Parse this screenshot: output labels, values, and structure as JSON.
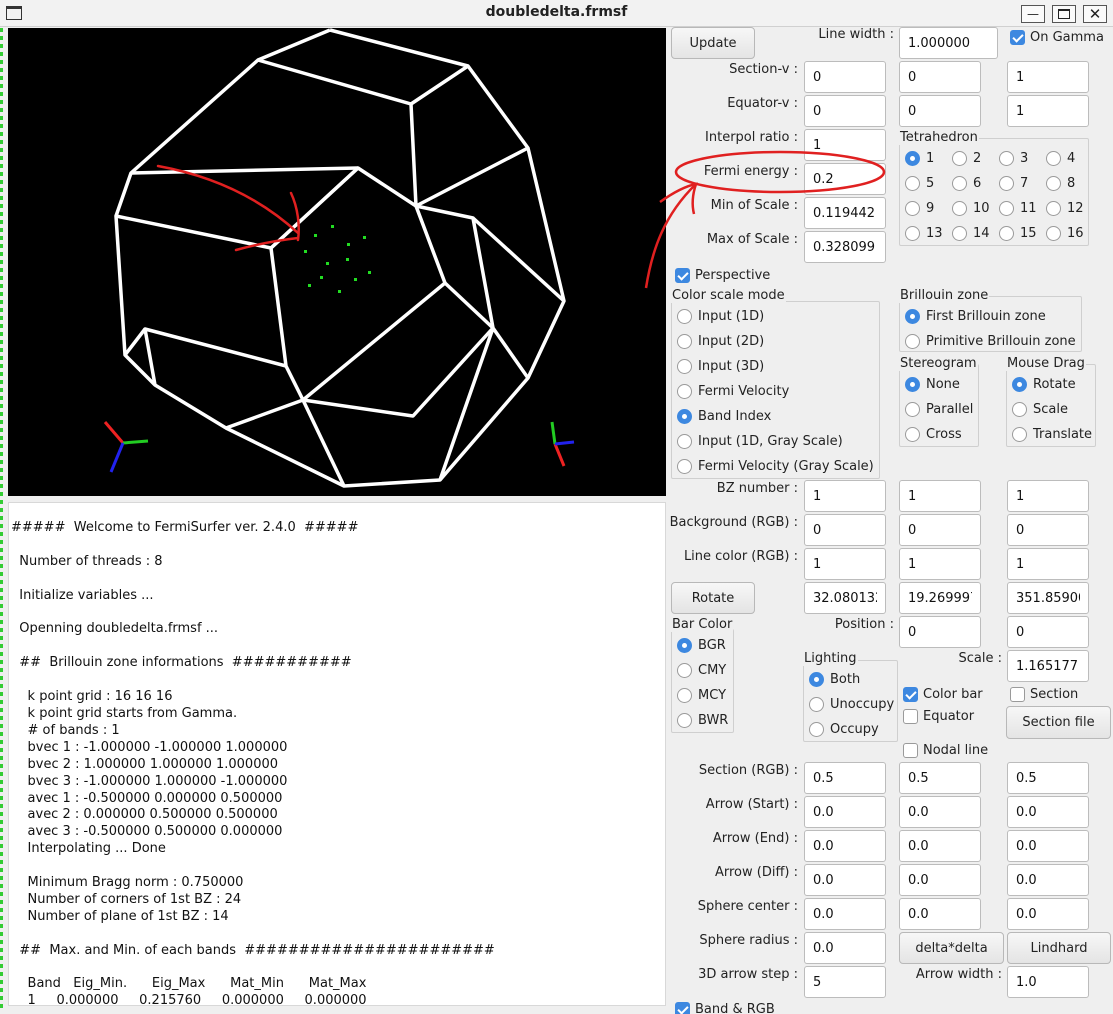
{
  "window": {
    "title": "doubledelta.frmsf"
  },
  "console_lines": [
    "#####  Welcome to FermiSurfer ver. 2.4.0  #####",
    "",
    "  Number of threads : 8",
    "",
    "  Initialize variables ...",
    "",
    "  Openning doubledelta.frmsf ...",
    "",
    "  ##  Brillouin zone informations  ###########",
    "",
    "    k point grid : 16 16 16",
    "    k point grid starts from Gamma.",
    "    # of bands : 1",
    "    bvec 1 : -1.000000 -1.000000 1.000000",
    "    bvec 2 : 1.000000 1.000000 1.000000",
    "    bvec 3 : -1.000000 1.000000 -1.000000",
    "    avec 1 : -0.500000 0.000000 0.500000",
    "    avec 2 : 0.000000 0.500000 0.500000",
    "    avec 3 : -0.500000 0.500000 0.000000",
    "    Interpolating ... Done",
    "",
    "    Minimum Bragg norm : 0.750000",
    "    Number of corners of 1st BZ : 24",
    "    Number of plane of 1st BZ : 14",
    "",
    "  ##  Max. and Min. of each bands  #######################",
    "",
    "    Band   Eig_Min.      Eig_Max      Mat_Min      Mat_Max",
    "    1     0.000000     0.215760     0.000000     0.000000"
  ],
  "buttons": {
    "update": "Update",
    "rotate": "Rotate",
    "section_file": "Section file",
    "delta_delta": "delta*delta",
    "lindhard": "Lindhard"
  },
  "labels": {
    "line_width": "Line width :",
    "section_v": "Section-v :",
    "equator_v": "Equator-v :",
    "interpol_ratio": "Interpol ratio :",
    "fermi_energy": "Fermi energy :",
    "min_scale": "Min of Scale :",
    "max_scale": "Max of Scale :",
    "bz_number": "BZ number :",
    "background_rgb": "Background (RGB) :",
    "line_color_rgb": "Line color (RGB) :",
    "position": "Position :",
    "scale": "Scale :",
    "section_rgb": "Section (RGB) :",
    "arrow_start": "Arrow (Start) :",
    "arrow_end": "Arrow (End) :",
    "arrow_diff": "Arrow (Diff) :",
    "sphere_center": "Sphere center :",
    "sphere_radius": "Sphere radius :",
    "arrow_step": "3D arrow step :",
    "arrow_width": "Arrow width :"
  },
  "fields": {
    "line_width": "1.000000",
    "section_v": [
      "0",
      "0",
      "1"
    ],
    "equator_v": [
      "0",
      "0",
      "1"
    ],
    "interpol_ratio": "1",
    "fermi_energy": "0.2",
    "min_scale": "0.119442",
    "max_scale": "0.328099",
    "bz_number": [
      "1",
      "1",
      "1"
    ],
    "background_rgb": [
      "0",
      "0",
      "0"
    ],
    "line_color_rgb": [
      "1",
      "1",
      "1"
    ],
    "rotate": [
      "32.080132",
      "19.269997",
      "351.85900"
    ],
    "position": [
      "0",
      "0"
    ],
    "scale": "1.165177",
    "section_rgb": [
      "0.5",
      "0.5",
      "0.5"
    ],
    "arrow_start": [
      "0.0",
      "0.0",
      "0.0"
    ],
    "arrow_end": [
      "0.0",
      "0.0",
      "0.0"
    ],
    "arrow_diff": [
      "0.0",
      "0.0",
      "0.0"
    ],
    "sphere_center": [
      "0.0",
      "0.0",
      "0.0"
    ],
    "sphere_radius": "0.0",
    "arrow_step": "5",
    "arrow_width": "1.0"
  },
  "checks": {
    "on_gamma": "On Gamma",
    "perspective": "Perspective",
    "color_bar": "Color bar",
    "section": "Section",
    "equator": "Equator",
    "nodal_line": "Nodal line"
  },
  "groups": {
    "tetrahedron": "Tetrahedron",
    "color_scale_mode": "Color scale mode",
    "brillouin_zone": "Brillouin zone",
    "stereogram": "Stereogram",
    "mouse_drag": "Mouse Drag",
    "bar_color": "Bar Color",
    "lighting": "Lighting"
  },
  "tetrahedron_options": [
    "1",
    "2",
    "3",
    "4",
    "5",
    "6",
    "7",
    "8",
    "9",
    "10",
    "11",
    "12",
    "13",
    "14",
    "15",
    "16"
  ],
  "color_scale_options": [
    "Input (1D)",
    "Input (2D)",
    "Input (3D)",
    "Fermi Velocity",
    "Band Index",
    "Input (1D, Gray Scale)",
    "Fermi Velocity (Gray Scale)"
  ],
  "bz_options": [
    "First Brillouin zone",
    "Primitive Brillouin zone"
  ],
  "stereogram_options": [
    "None",
    "Parallel",
    "Cross"
  ],
  "mouse_drag_options": [
    "Rotate",
    "Scale",
    "Translate"
  ],
  "bar_color_options": [
    "BGR",
    "CMY",
    "MCY",
    "BWR"
  ],
  "lighting_options": [
    "Both",
    "Unoccupy",
    "Occupy"
  ],
  "bottom_partial": "Band & RGB"
}
